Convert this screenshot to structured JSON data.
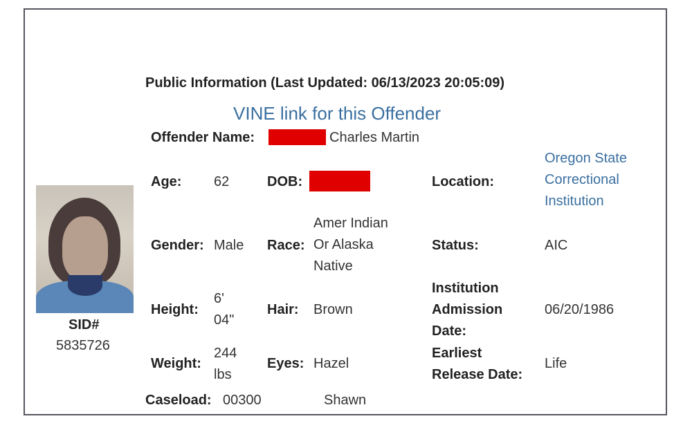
{
  "header": {
    "public_info": "Public Information (Last Updated: 06/13/2023 20:05:09)",
    "vine_link": "VINE link for this Offender"
  },
  "offender": {
    "name_label": "Offender Name:",
    "name_value": "Charles Martin",
    "sid_label": "SID#",
    "sid_value": "5835726"
  },
  "details": {
    "age_label": "Age:",
    "age_value": "62",
    "dob_label": "DOB:",
    "location_label": "Location:",
    "location_line1": "Oregon State",
    "location_line2": "Correctional",
    "location_line3": "Institution",
    "gender_label": "Gender:",
    "gender_value": "Male",
    "race_label": "Race:",
    "race_line1": "Amer Indian",
    "race_line2": "Or Alaska",
    "race_line3": "Native",
    "status_label": "Status:",
    "status_value": "AIC",
    "height_label": "Height:",
    "height_line1": "6'",
    "height_line2": "04\"",
    "hair_label": "Hair:",
    "hair_value": "Brown",
    "admission_line1": "Institution",
    "admission_line2": "Admission",
    "admission_line3": "Date:",
    "admission_value": "06/20/1986",
    "weight_label": "Weight:",
    "weight_line1": "244",
    "weight_line2": "lbs",
    "eyes_label": "Eyes:",
    "eyes_value": "Hazel",
    "release_line1": "Earliest",
    "release_line2": "Release Date:",
    "release_value": "Life",
    "caseload_label": "Caseload:",
    "caseload_value": "00300",
    "officer_value": "Shawn"
  },
  "colors": {
    "link": "#3a6fa0",
    "redaction": "#e00000",
    "border": "#55555f"
  }
}
